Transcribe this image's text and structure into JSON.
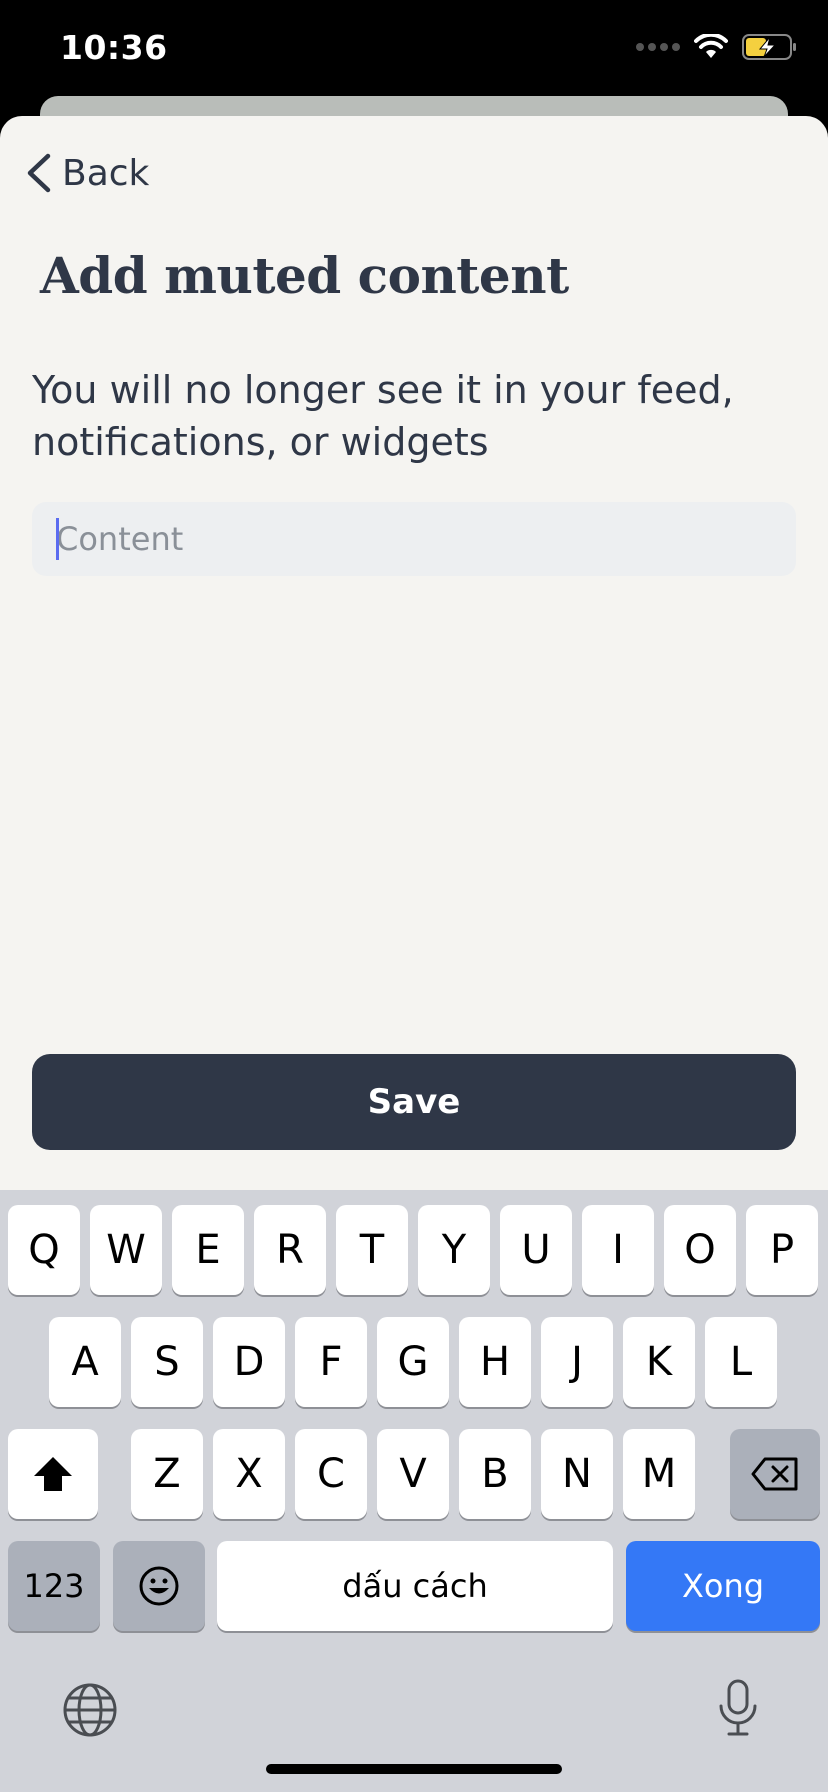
{
  "status_bar": {
    "time": "10:36"
  },
  "nav": {
    "back_label": "Back"
  },
  "page": {
    "title": "Add muted content",
    "description": "You will no longer see it in your feed, notifications, or widgets"
  },
  "input": {
    "placeholder": "Content",
    "value": ""
  },
  "save": {
    "label": "Save"
  },
  "keyboard": {
    "row1": [
      "Q",
      "W",
      "E",
      "R",
      "T",
      "Y",
      "U",
      "I",
      "O",
      "P"
    ],
    "row2": [
      "A",
      "S",
      "D",
      "F",
      "G",
      "H",
      "J",
      "K",
      "L"
    ],
    "row3": [
      "Z",
      "X",
      "C",
      "V",
      "B",
      "N",
      "M"
    ],
    "numbers_label": "123",
    "space_label": "dấu cách",
    "done_label": "Xong"
  },
  "colors": {
    "primary": "#2f3747",
    "sheet_bg": "#f5f4f1",
    "input_bg": "#edeff1",
    "keyboard_bg": "#d1d3d9",
    "done_key": "#3478f6",
    "caret": "#5b6cf0"
  }
}
